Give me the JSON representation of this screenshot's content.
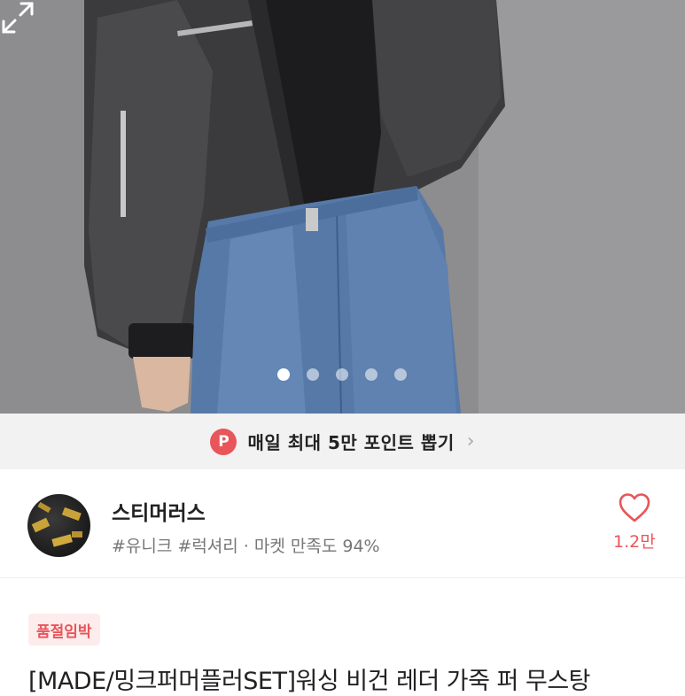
{
  "hero": {
    "image_alt": "product photo",
    "expand_icon": "expand-icon",
    "carousel": {
      "total": 5,
      "active": 1
    }
  },
  "banner": {
    "badge": "P",
    "text": "매일 최대 5만 포인트 뽑기",
    "chevron": "›"
  },
  "seller": {
    "name": "스티머러스",
    "tags": "#유니크 #럭셔리 · 마켓 만족도 94%",
    "likes": "1.2만",
    "heart_icon": "heart-outline-icon"
  },
  "product": {
    "badge": "품절임박",
    "title": "[MADE/밍크퍼머플러SET]워싱 비건 레더 가죽 퍼 무스탕"
  },
  "colors": {
    "accent": "#e8555a",
    "banner_bg": "#f2f2f2"
  }
}
